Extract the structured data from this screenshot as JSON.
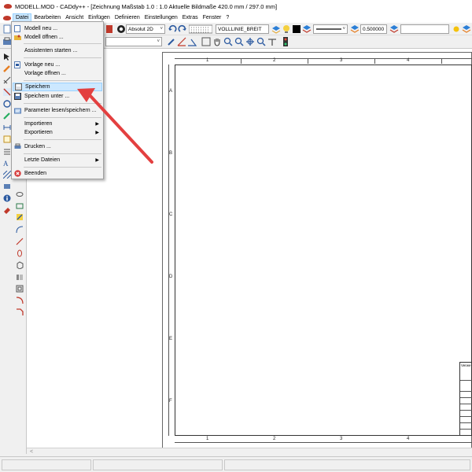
{
  "window": {
    "title": "MODELL.MOD  -  CADdy++ - [Zeichnung    Maßstab 1.0 : 1.0   Aktuelle Bildmaße 420.0 mm / 297.0 mm]"
  },
  "menubar": {
    "items": [
      {
        "label": "Datei"
      },
      {
        "label": "Bearbeiten"
      },
      {
        "label": "Ansicht"
      },
      {
        "label": "Einfügen"
      },
      {
        "label": "Definieren"
      },
      {
        "label": "Einstellungen"
      },
      {
        "label": "Extras"
      },
      {
        "label": "Fenster"
      },
      {
        "label": "?"
      }
    ]
  },
  "toolbar": {
    "mode_value": "Absolut 2D",
    "linetype_value": "VOLLLINIE_BREIT",
    "linewidth_value": "0.500000",
    "text_value": ""
  },
  "file_menu": {
    "items": [
      {
        "label": "Modell neu ...",
        "icon": "new-model-icon"
      },
      {
        "label": "Modell öffnen ...",
        "icon": "open-model-icon"
      },
      {
        "label": "Assistenten starten ...",
        "icon": ""
      },
      {
        "label": "Vorlage neu ...",
        "icon": "new-template-icon"
      },
      {
        "label": "Vorlage öffnen ...",
        "icon": ""
      },
      {
        "label": "Speichern",
        "icon": "save-icon"
      },
      {
        "label": "Speichern unter ...",
        "icon": "save-as-icon"
      },
      {
        "label": "Parameter lesen/speichern ...",
        "icon": "parameter-icon"
      },
      {
        "label": "Importieren",
        "icon": ""
      },
      {
        "label": "Exportieren",
        "icon": ""
      },
      {
        "label": "Drucken ...",
        "icon": "print-icon"
      },
      {
        "label": "Letzte Dateien",
        "icon": ""
      },
      {
        "label": "Beenden",
        "icon": "exit-icon"
      }
    ]
  },
  "drawing": {
    "columns": [
      "1",
      "2",
      "3",
      "4"
    ],
    "rows": [
      "A",
      "B",
      "C",
      "D",
      "E",
      "F"
    ],
    "title_block_text": "Verwe"
  },
  "colors": {
    "highlight": "#cce8ff",
    "arrow": "#e34040",
    "app_red": "#c0392b"
  }
}
